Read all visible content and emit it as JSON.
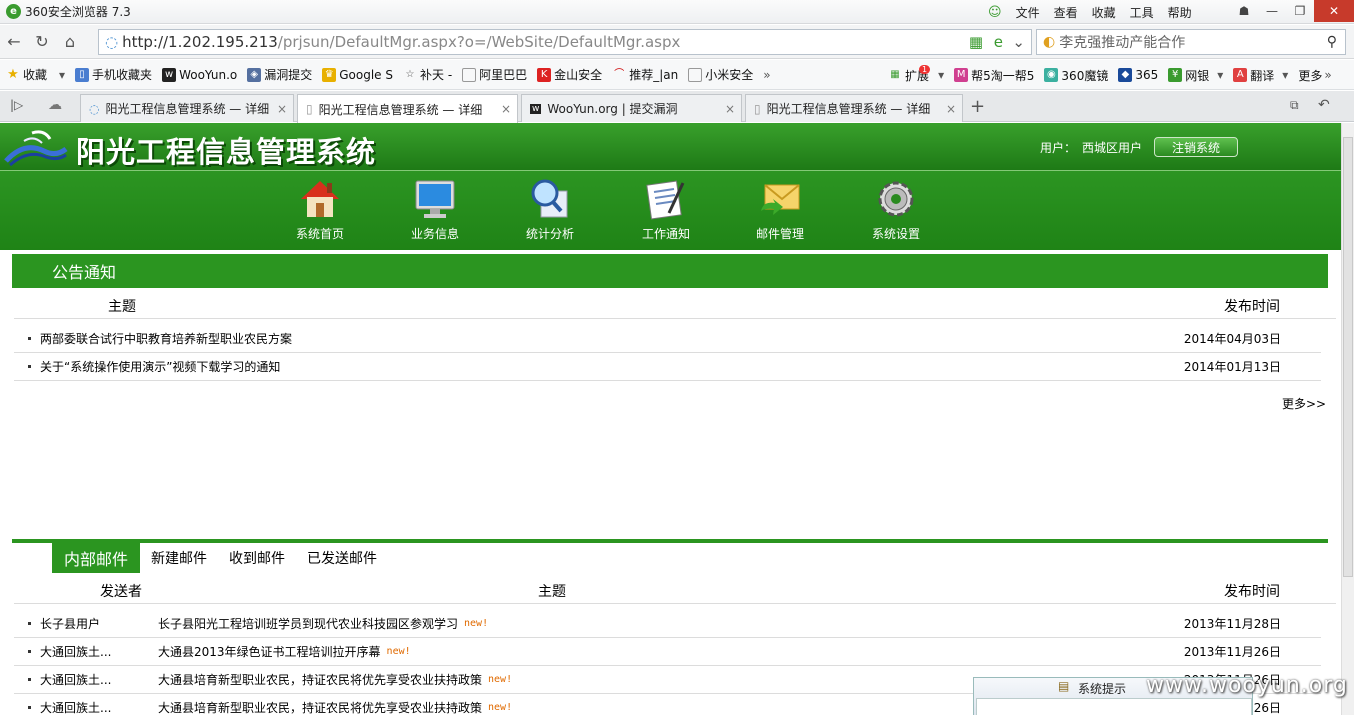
{
  "browser": {
    "title": "360安全浏览器 7.3",
    "menus": [
      "文件",
      "查看",
      "收藏",
      "工具",
      "帮助"
    ],
    "url_host": "http://1.202.195.213",
    "url_path": "/prjsun/DefaultMgr.aspx?o=/WebSite/DefaultMgr.aspx",
    "search_text": "李克强推动产能合作"
  },
  "bookmarks": {
    "left": [
      "收藏",
      "手机收藏夹",
      "WooYun.o",
      "漏洞提交",
      "Google S",
      "补天 -",
      "阿里巴巴",
      "金山安全",
      "推荐_|an",
      "小米安全"
    ],
    "right": [
      "扩展",
      "帮5淘一帮5",
      "360魔镜",
      "365",
      "网银",
      "翻译",
      "更多"
    ],
    "ext_badge": "1"
  },
  "tabs": [
    "阳光工程信息管理系统 — 详细",
    "阳光工程信息管理系统 — 详细",
    "WooYun.org | 提交漏洞",
    "阳光工程信息管理系统 — 详细"
  ],
  "site": {
    "title": "阳光工程信息管理系统",
    "user_label": "用户：",
    "user_name": "西城区用户",
    "logout": "注销系统",
    "nav": [
      "系统首页",
      "业务信息",
      "统计分析",
      "工作通知",
      "邮件管理",
      "系统设置"
    ]
  },
  "notice": {
    "heading": "公告通知",
    "col_subject": "主题",
    "col_date": "发布时间",
    "rows": [
      {
        "title": "两部委联合试行中职教育培养新型职业农民方案",
        "date": "2014年04月03日"
      },
      {
        "title": "关于“系统操作使用演示”视频下载学习的通知",
        "date": "2014年01月13日"
      }
    ],
    "more": "更多>>"
  },
  "mail": {
    "tabs": [
      "内部邮件",
      "新建邮件",
      "收到邮件",
      "已发送邮件"
    ],
    "col_sender": "发送者",
    "col_subject": "主题",
    "col_date": "发布时间",
    "new_tag": "new!",
    "rows": [
      {
        "sender": "长子县用户",
        "title": "长子县阳光工程培训班学员到现代农业科技园区参观学习",
        "date": "2013年11月28日"
      },
      {
        "sender": "大通回族土...",
        "title": "大通县2013年绿色证书工程培训拉开序幕",
        "date": "2013年11月26日"
      },
      {
        "sender": "大通回族土...",
        "title": "大通县培育新型职业农民，持证农民将优先享受农业扶持政策",
        "date": "2013年11月26日"
      },
      {
        "sender": "大通回族土...",
        "title": "大通县培育新型职业农民，持证农民将优先享受农业扶持政策",
        "date": "2013年11月26日"
      }
    ]
  },
  "popup": {
    "title": "系统提示"
  },
  "watermark": "www.wooyun.org"
}
